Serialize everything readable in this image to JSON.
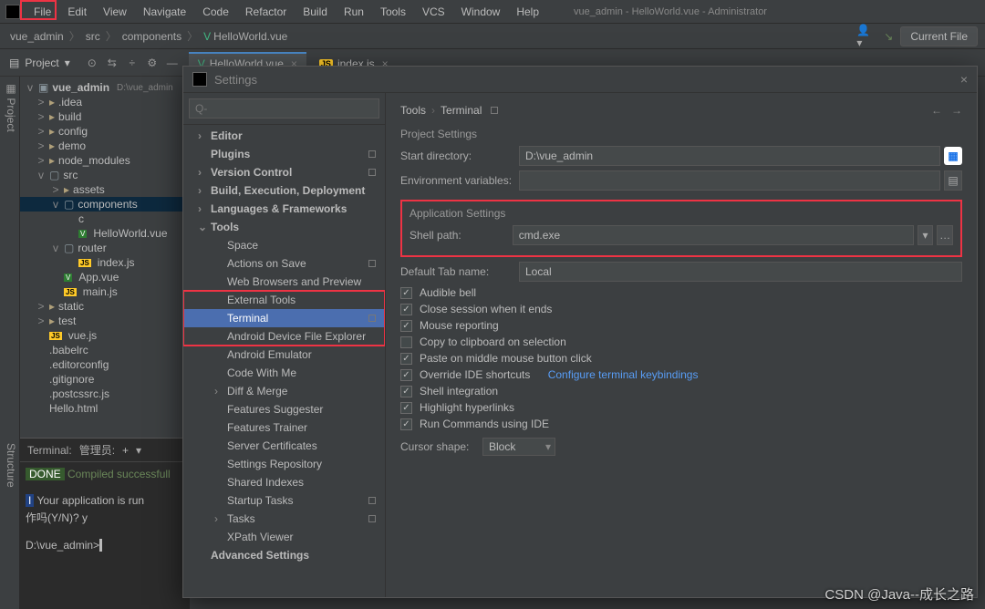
{
  "menu": {
    "items": [
      "File",
      "Edit",
      "View",
      "Navigate",
      "Code",
      "Refactor",
      "Build",
      "Run",
      "Tools",
      "VCS",
      "Window",
      "Help"
    ],
    "title": "vue_admin - HelloWorld.vue - Administrator"
  },
  "breadcrumb": [
    "vue_admin",
    "src",
    "components",
    "HelloWorld.vue"
  ],
  "navRight": {
    "currentFile": "Current File"
  },
  "projectLabel": "Project",
  "tabs": [
    {
      "icon": "vue",
      "label": "HelloWorld.vue"
    },
    {
      "icon": "js",
      "label": "index.js"
    }
  ],
  "tree": {
    "root": {
      "name": "vue_admin",
      "hint": "D:\\vue_admin"
    },
    "nodes": [
      {
        "l": 1,
        "t": "fold",
        "exp": ">",
        "name": ".idea"
      },
      {
        "l": 1,
        "t": "fold",
        "exp": ">",
        "name": "build"
      },
      {
        "l": 1,
        "t": "fold",
        "exp": ">",
        "name": "config"
      },
      {
        "l": 1,
        "t": "fold",
        "exp": ">",
        "name": "demo"
      },
      {
        "l": 1,
        "t": "fold",
        "exp": ">",
        "name": "node_modules"
      },
      {
        "l": 1,
        "t": "fold",
        "exp": "v",
        "name": "src",
        "open": true
      },
      {
        "l": 2,
        "t": "fold",
        "exp": ">",
        "name": "assets"
      },
      {
        "l": 2,
        "t": "fold",
        "exp": "v",
        "name": "components",
        "open": true,
        "sel": true
      },
      {
        "l": 3,
        "t": "file",
        "icon": "",
        "name": "c"
      },
      {
        "l": 3,
        "t": "file",
        "icon": "vue",
        "name": "HelloWorld.vue"
      },
      {
        "l": 2,
        "t": "fold",
        "exp": "v",
        "name": "router",
        "open": true
      },
      {
        "l": 3,
        "t": "file",
        "icon": "js",
        "name": "index.js"
      },
      {
        "l": 2,
        "t": "file",
        "icon": "vue",
        "name": "App.vue"
      },
      {
        "l": 2,
        "t": "file",
        "icon": "js",
        "name": "main.js"
      },
      {
        "l": 1,
        "t": "fold",
        "exp": ">",
        "name": "static"
      },
      {
        "l": 1,
        "t": "fold",
        "exp": ">",
        "name": "test"
      },
      {
        "l": 1,
        "t": "file",
        "icon": "js",
        "name": "vue.js"
      },
      {
        "l": 1,
        "t": "file",
        "name": ".babelrc"
      },
      {
        "l": 1,
        "t": "file",
        "name": ".editorconfig"
      },
      {
        "l": 1,
        "t": "file",
        "name": ".gitignore"
      },
      {
        "l": 1,
        "t": "file",
        "name": ".postcssrc.js"
      },
      {
        "l": 1,
        "t": "file",
        "name": "Hello.html"
      }
    ]
  },
  "terminal": {
    "title": "Terminal:",
    "tab": "管理员:",
    "doneLabel": "DONE",
    "doneText": "Compiled successfull",
    "appText": "Your application is run",
    "iLabel": "I",
    "prompt1": "作吗(Y/N)? y",
    "prompt2": "D:\\vue_admin>"
  },
  "settings": {
    "title": "Settings",
    "searchPlaceholder": "Q-",
    "side": [
      {
        "label": "Editor",
        "type": "top",
        "exp": ">"
      },
      {
        "label": "Plugins",
        "type": "top",
        "sq": true
      },
      {
        "label": "Version Control",
        "type": "top",
        "exp": ">",
        "sq": true
      },
      {
        "label": "Build, Execution, Deployment",
        "type": "top",
        "exp": ">"
      },
      {
        "label": "Languages & Frameworks",
        "type": "top",
        "exp": ">"
      },
      {
        "label": "Tools",
        "type": "top",
        "exp": "v"
      },
      {
        "label": "Space",
        "type": "sub"
      },
      {
        "label": "Actions on Save",
        "type": "sub",
        "sq": true
      },
      {
        "label": "Web Browsers and Preview",
        "type": "sub"
      },
      {
        "label": "External Tools",
        "type": "sub",
        "boxedTop": true
      },
      {
        "label": "Terminal",
        "type": "sub",
        "sel": true,
        "sq": true
      },
      {
        "label": "Android Device File Explorer",
        "type": "sub",
        "boxedBot": true
      },
      {
        "label": "Android Emulator",
        "type": "sub"
      },
      {
        "label": "Code With Me",
        "type": "sub"
      },
      {
        "label": "Diff & Merge",
        "type": "sub",
        "exp": ">"
      },
      {
        "label": "Features Suggester",
        "type": "sub"
      },
      {
        "label": "Features Trainer",
        "type": "sub"
      },
      {
        "label": "Server Certificates",
        "type": "sub"
      },
      {
        "label": "Settings Repository",
        "type": "sub"
      },
      {
        "label": "Shared Indexes",
        "type": "sub"
      },
      {
        "label": "Startup Tasks",
        "type": "sub",
        "sq": true
      },
      {
        "label": "Tasks",
        "type": "sub",
        "exp": ">",
        "sq": true
      },
      {
        "label": "XPath Viewer",
        "type": "sub"
      },
      {
        "label": "Advanced Settings",
        "type": "top"
      }
    ],
    "crumb": [
      "Tools",
      "Terminal"
    ],
    "projSection": "Project Settings",
    "startDir": {
      "label": "Start directory:",
      "value": "D:\\vue_admin"
    },
    "envVar": {
      "label": "Environment variables:",
      "value": ""
    },
    "appSection": "Application Settings",
    "shellPath": {
      "label": "Shell path:",
      "value": "cmd.exe"
    },
    "defaultTab": {
      "label": "Default Tab name:",
      "value": "Local"
    },
    "checks": [
      {
        "c": true,
        "label": "Audible bell"
      },
      {
        "c": true,
        "label": "Close session when it ends"
      },
      {
        "c": true,
        "label": "Mouse reporting"
      },
      {
        "c": false,
        "label": "Copy to clipboard on selection"
      },
      {
        "c": true,
        "label": "Paste on middle mouse button click"
      },
      {
        "c": true,
        "label": "Override IDE shortcuts",
        "link": "Configure terminal keybindings"
      },
      {
        "c": true,
        "label": "Shell integration"
      },
      {
        "c": true,
        "label": "Highlight hyperlinks"
      },
      {
        "c": true,
        "label": "Run Commands using IDE"
      }
    ],
    "cursor": {
      "label": "Cursor shape:",
      "value": "Block"
    }
  },
  "watermark": "CSDN @Java--成长之路"
}
